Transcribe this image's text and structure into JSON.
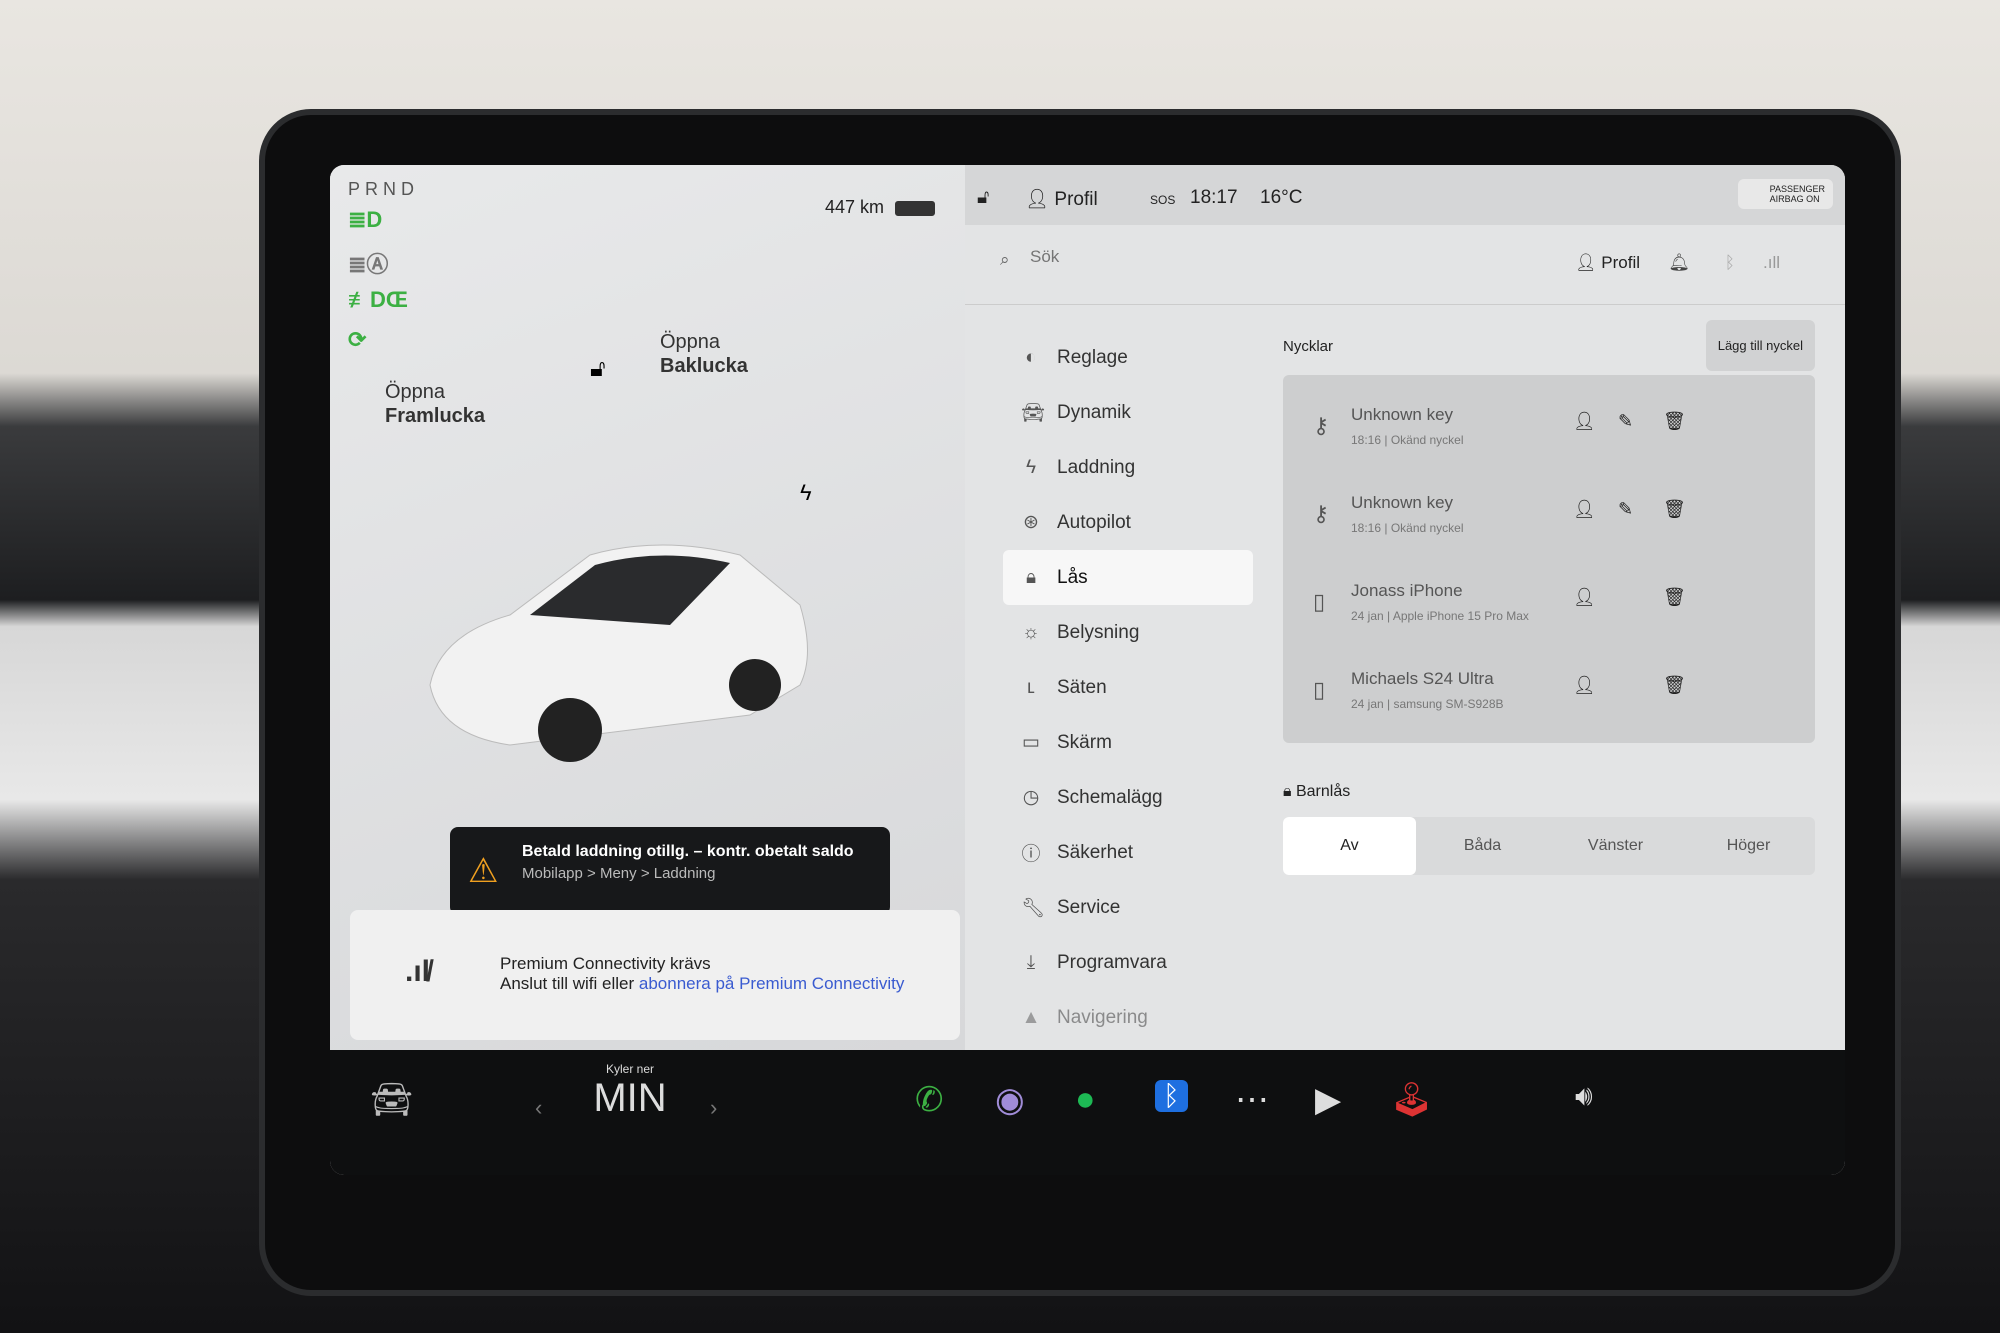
{
  "status": {
    "gear": "PRND",
    "range": "447 km",
    "profile": "Profil",
    "sos": "SOS",
    "time": "18:17",
    "temp": "16°C",
    "airbag": [
      "PASSENGER",
      "AIRBAG ON"
    ]
  },
  "car": {
    "front_trunk": [
      "Öppna",
      "Framlucka"
    ],
    "rear_trunk": [
      "Öppna",
      "Baklucka"
    ]
  },
  "alert": {
    "title": "Betald laddning otillg. – kontr. obetalt saldo",
    "subtitle": "Mobilapp > Meny > Laddning"
  },
  "connectivity": {
    "title": "Premium Connectivity krävs",
    "text": "Anslut till wifi eller ",
    "link": "abonnera på Premium Connectivity"
  },
  "search": {
    "placeholder": "Sök",
    "profile": "Profil"
  },
  "menu": [
    {
      "label": "Reglage",
      "icon": "toggle-icon"
    },
    {
      "label": "Dynamik",
      "icon": "car-icon"
    },
    {
      "label": "Laddning",
      "icon": "bolt-icon"
    },
    {
      "label": "Autopilot",
      "icon": "steering-wheel-icon"
    },
    {
      "label": "Lås",
      "icon": "lock-icon",
      "selected": true
    },
    {
      "label": "Belysning",
      "icon": "sun-icon"
    },
    {
      "label": "Säten",
      "icon": "seat-icon"
    },
    {
      "label": "Skärm",
      "icon": "display-icon"
    },
    {
      "label": "Schemalägg",
      "icon": "clock-icon"
    },
    {
      "label": "Säkerhet",
      "icon": "alert-circle-icon"
    },
    {
      "label": "Service",
      "icon": "wrench-icon"
    },
    {
      "label": "Programvara",
      "icon": "download-icon"
    },
    {
      "label": "Navigering",
      "icon": "navigation-icon"
    }
  ],
  "keys": {
    "title": "Nycklar",
    "add": "Lägg till nyckel",
    "items": [
      {
        "name": "Unknown key",
        "detail": "18:16 | Okänd nyckel",
        "type": "key",
        "editable": true
      },
      {
        "name": "Unknown key",
        "detail": "18:16 | Okänd nyckel",
        "type": "key",
        "editable": true
      },
      {
        "name": "Jonass iPhone",
        "detail": "24 jan | Apple iPhone 15 Pro Max",
        "type": "phone",
        "editable": false
      },
      {
        "name": "Michaels S24 Ultra",
        "detail": "24 jan | samsung SM-S928B",
        "type": "phone",
        "editable": false
      }
    ]
  },
  "child_lock": {
    "title": "Barnlås",
    "options": [
      "Av",
      "Båda",
      "Vänster",
      "Höger"
    ],
    "selected": "Av"
  },
  "climate": {
    "label": "Kyler ner",
    "value": "MIN"
  },
  "colors": {
    "alert_icon": "#f0a020",
    "link": "#3a5bd0",
    "indicator": "#3cb043",
    "spotify": "#1db954",
    "bluetooth": "#1e6fe0"
  }
}
